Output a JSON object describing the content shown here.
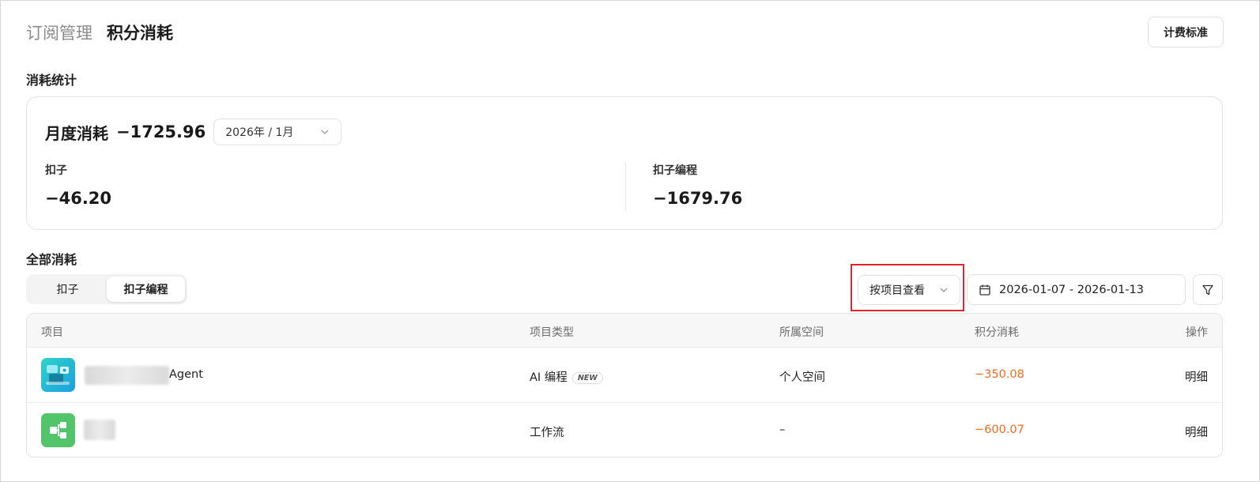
{
  "header": {
    "breadcrumb_parent": "订阅管理",
    "breadcrumb_current": "积分消耗",
    "billing_standard_button": "计费标准"
  },
  "stats": {
    "section_title": "消耗统计",
    "monthly_label": "月度消耗",
    "monthly_value": "−1725.96",
    "month_select": "2026年 / 1月",
    "items": [
      {
        "label": "扣子",
        "value": "−46.20"
      },
      {
        "label": "扣子编程",
        "value": "−1679.76"
      }
    ]
  },
  "all": {
    "section_title": "全部消耗",
    "tabs": [
      {
        "label": "扣子",
        "selected": false
      },
      {
        "label": "扣子编程",
        "selected": true
      }
    ],
    "view_select": "按项目查看",
    "date_range": "2026-01-07 - 2026-01-13",
    "icons": {
      "calendar": "calendar-icon",
      "filter": "filter-icon",
      "chevron": "chevron-down-icon"
    }
  },
  "table": {
    "columns": [
      "项目",
      "项目类型",
      "所属空间",
      "积分消耗",
      "操作"
    ],
    "rows": [
      {
        "name_suffix": "Agent",
        "type": "AI 编程",
        "badge": "NEW",
        "space": "个人空间",
        "cost": "−350.08",
        "action": "明细"
      },
      {
        "name_suffix": "",
        "type": "工作流",
        "badge": "",
        "space": "–",
        "cost": "−600.07",
        "action": "明细"
      }
    ]
  },
  "colors": {
    "cost": "#f56a1e",
    "highlight": "#e5252a",
    "workflow_icon": "#52c46a"
  }
}
